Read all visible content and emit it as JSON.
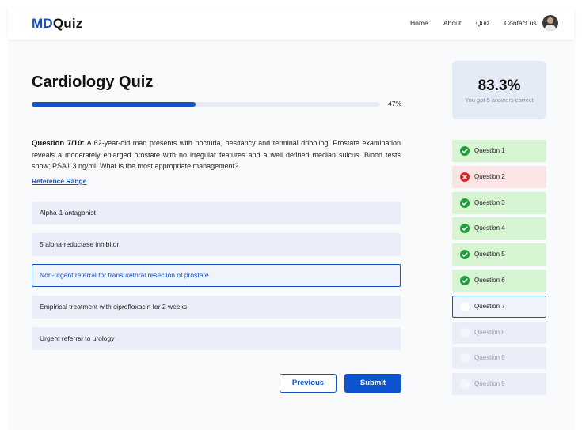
{
  "brand": {
    "md": "MD",
    "quiz": "Quiz",
    "accent": "#1652c4"
  },
  "nav": {
    "home": "Home",
    "about": "About",
    "quiz": "Quiz",
    "contact": "Contact us"
  },
  "quiz": {
    "title": "Cardiology Quiz",
    "progress_fraction": 0.47,
    "progress_label": "47%",
    "question_number": "Question 7/10:",
    "question_text": "A 62-year-old man presents with nocturia, hesitancy and terminal dribbling. Prostate examination reveals a moderately enlarged prostate with no irregular features and a well defined median sulcus. Blood tests show; PSA1.3 ng/ml. What is the most appropriate management?",
    "reference_link": "Reference Range",
    "options": [
      {
        "label": "Alpha-1 antagonist",
        "selected": false
      },
      {
        "label": "5 alpha-reductase inhibitor",
        "selected": false
      },
      {
        "label": "Non-urgent referral for transurethral resection of prostate",
        "selected": true
      },
      {
        "label": "Empirical treatment with ciprofloxacin for 2 weeks",
        "selected": false
      },
      {
        "label": "Urgent referral to urology",
        "selected": false
      }
    ],
    "previous_label": "Previous",
    "submit_label": "Submit"
  },
  "score": {
    "value": "83.3%",
    "subtitle": "You got 5 answers correct"
  },
  "questions": [
    {
      "label": "Question 1",
      "status": "correct",
      "icon": "check-circle-icon"
    },
    {
      "label": "Question 2",
      "status": "incorrect",
      "icon": "x-circle-icon"
    },
    {
      "label": "Question 3",
      "status": "correct",
      "icon": "check-circle-icon"
    },
    {
      "label": "Question 4",
      "status": "correct",
      "icon": "check-circle-icon"
    },
    {
      "label": "Question 5",
      "status": "correct",
      "icon": "check-circle-icon"
    },
    {
      "label": "Question 6",
      "status": "correct",
      "icon": "check-circle-icon"
    },
    {
      "label": "Question 7",
      "status": "current",
      "icon": "empty-circle-icon"
    },
    {
      "label": "Question 8",
      "status": "pending",
      "icon": "empty-circle-icon"
    },
    {
      "label": "Question 9",
      "status": "pending",
      "icon": "empty-circle-icon"
    },
    {
      "label": "Question 9",
      "status": "pending",
      "icon": "empty-circle-icon"
    }
  ]
}
